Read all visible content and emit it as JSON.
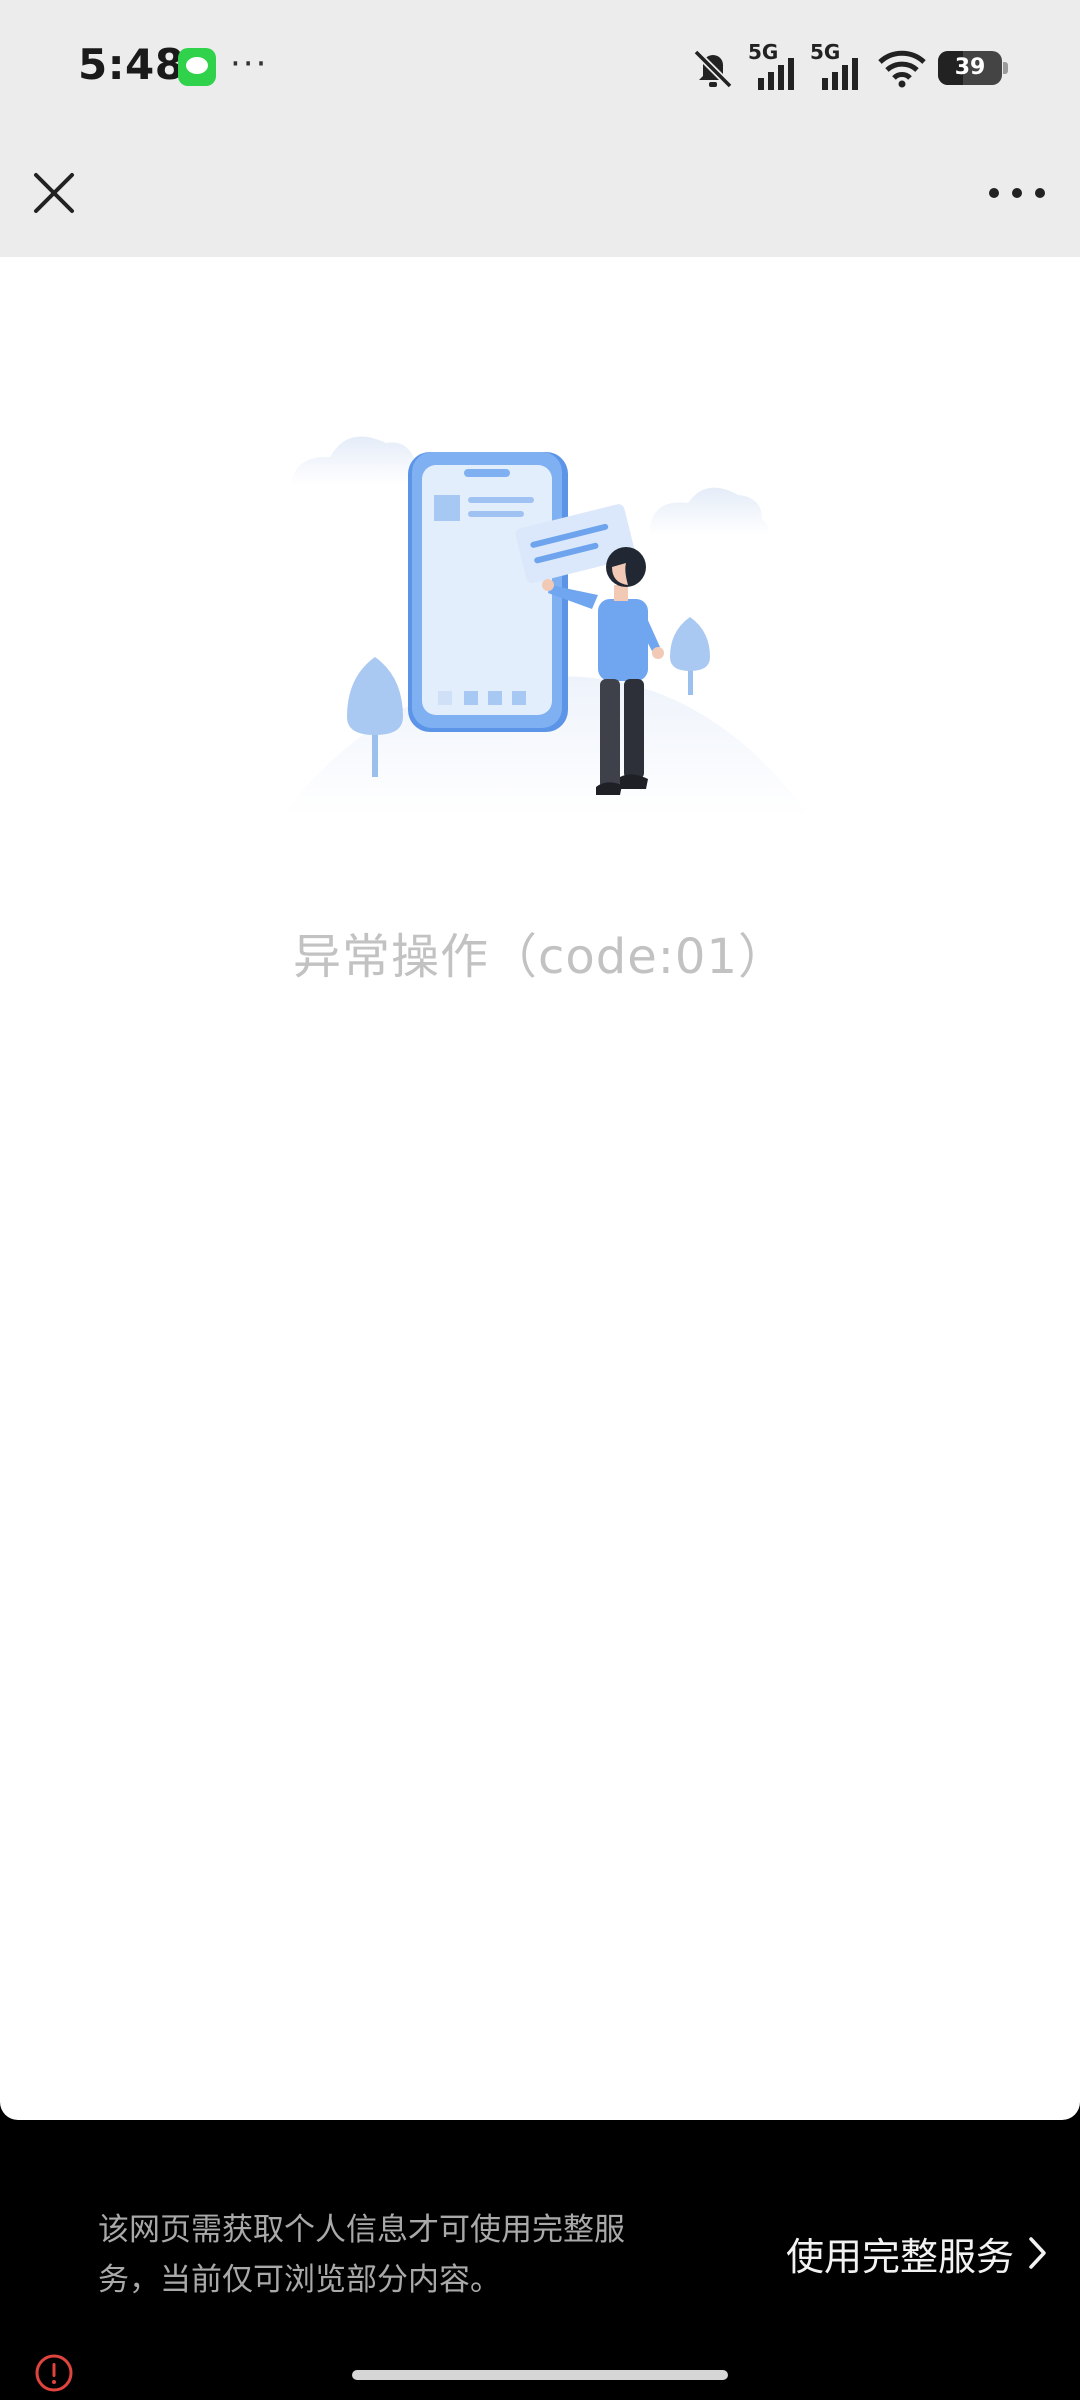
{
  "status_bar": {
    "time": "5:48",
    "more": "···",
    "network_1": "5G",
    "network_2": "5G",
    "battery_level": "39",
    "icons": [
      "message-icon",
      "mute-icon",
      "signal-icon",
      "signal-icon",
      "wifi-icon",
      "battery-icon"
    ]
  },
  "nav": {
    "close_icon": "close-icon",
    "more_icon": "more-icon"
  },
  "main": {
    "error_message": "异常操作（code:01）"
  },
  "footer": {
    "notice": "该网页需获取个人信息才可使用完整服务，当前仅可浏览部分内容。",
    "action_label": "使用完整服务",
    "warning_color": "#e0443e"
  }
}
